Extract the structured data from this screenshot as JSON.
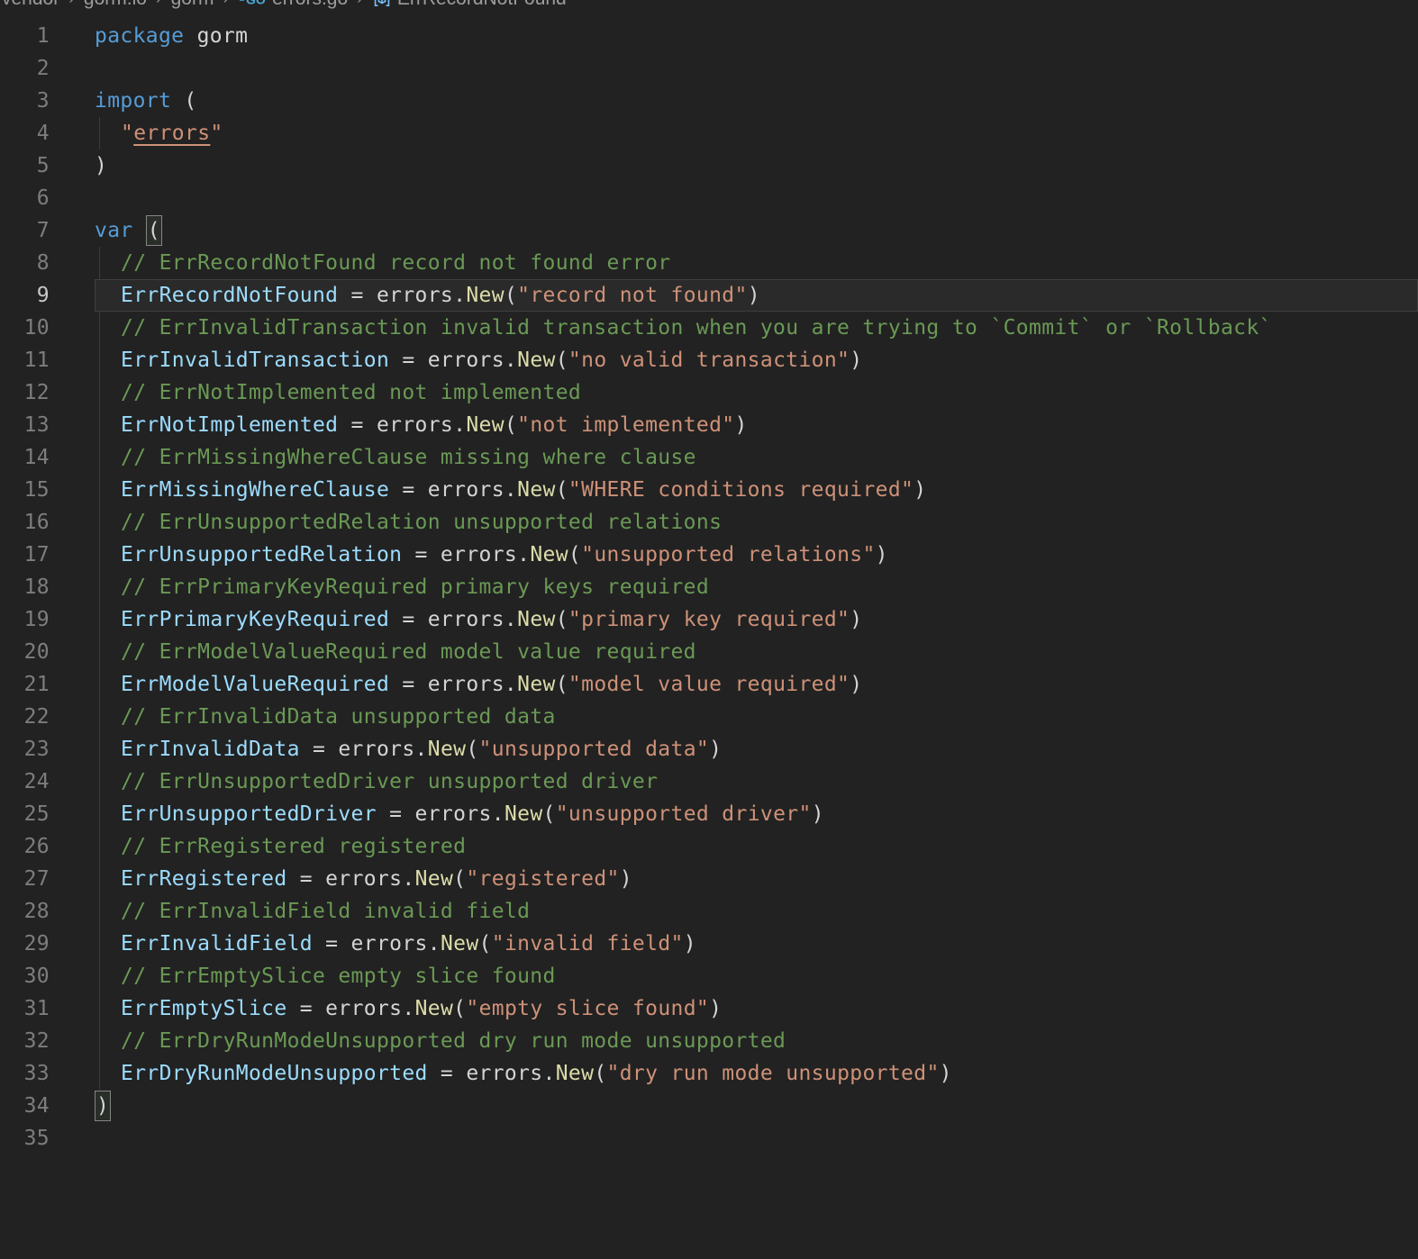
{
  "palette": {
    "bg": "#222222",
    "gutter-fg": "#7d7d7d",
    "gutter-active": "#c8c8c8",
    "kw": "#569cd6",
    "pl": "#d4d4d4",
    "cm": "#6a9955",
    "vr": "#9cdcfe",
    "fn": "#dcdcaa",
    "st": "#ce9178",
    "cur-bg": "#2a2a2a",
    "cur-border": "#3f3f3f",
    "guide": "#3c3c3c",
    "bracket": "#858585",
    "bc-fg": "#9d9d9d",
    "go-blue": "#4da6d6",
    "sym-blue": "#75beff"
  },
  "breadcrumb": {
    "separator": "›",
    "items": [
      {
        "label": "vendor"
      },
      {
        "label": "gorm.io"
      },
      {
        "label": "gorm"
      },
      {
        "label": "errors.go",
        "icon": "go-icon"
      },
      {
        "label": "ErrRecordNotFound",
        "icon": "symbol-variable-icon"
      }
    ]
  },
  "editor": {
    "lines": [
      {
        "n": 1,
        "indent": 0,
        "tokens": [
          [
            "kw",
            "package"
          ],
          [
            "pl",
            " gorm"
          ]
        ]
      },
      {
        "n": 2,
        "indent": 0,
        "tokens": []
      },
      {
        "n": 3,
        "indent": 0,
        "tokens": [
          [
            "kw",
            "import"
          ],
          [
            "pl",
            " ("
          ]
        ]
      },
      {
        "n": 4,
        "indent": 1,
        "guide": true,
        "tokens": [
          [
            "st",
            "\""
          ],
          [
            "stu",
            "errors"
          ],
          [
            "st",
            "\""
          ]
        ]
      },
      {
        "n": 5,
        "indent": 0,
        "tokens": [
          [
            "pl",
            ")"
          ]
        ]
      },
      {
        "n": 6,
        "indent": 0,
        "tokens": []
      },
      {
        "n": 7,
        "indent": 0,
        "tokens": [
          [
            "kw",
            "var"
          ],
          [
            "pl",
            " "
          ],
          [
            "bm",
            "("
          ]
        ]
      },
      {
        "n": 8,
        "indent": 1,
        "guide": true,
        "tokens": [
          [
            "cm",
            "// ErrRecordNotFound record not found error"
          ]
        ]
      },
      {
        "n": 9,
        "indent": 1,
        "current": true,
        "tokens": [
          [
            "vr",
            "ErrRecordNotFound"
          ],
          [
            "pl",
            " = errors."
          ],
          [
            "fn",
            "New"
          ],
          [
            "pl",
            "("
          ],
          [
            "st",
            "\"record not found\""
          ],
          [
            "pl",
            ")"
          ]
        ]
      },
      {
        "n": 10,
        "indent": 1,
        "guide": true,
        "tokens": [
          [
            "cm",
            "// ErrInvalidTransaction invalid transaction when you are trying to `Commit` or `Rollback`"
          ]
        ]
      },
      {
        "n": 11,
        "indent": 1,
        "guide": true,
        "tokens": [
          [
            "vr",
            "ErrInvalidTransaction"
          ],
          [
            "pl",
            " = errors."
          ],
          [
            "fn",
            "New"
          ],
          [
            "pl",
            "("
          ],
          [
            "st",
            "\"no valid transaction\""
          ],
          [
            "pl",
            ")"
          ]
        ]
      },
      {
        "n": 12,
        "indent": 1,
        "guide": true,
        "tokens": [
          [
            "cm",
            "// ErrNotImplemented not implemented"
          ]
        ]
      },
      {
        "n": 13,
        "indent": 1,
        "guide": true,
        "tokens": [
          [
            "vr",
            "ErrNotImplemented"
          ],
          [
            "pl",
            " = errors."
          ],
          [
            "fn",
            "New"
          ],
          [
            "pl",
            "("
          ],
          [
            "st",
            "\"not implemented\""
          ],
          [
            "pl",
            ")"
          ]
        ]
      },
      {
        "n": 14,
        "indent": 1,
        "guide": true,
        "tokens": [
          [
            "cm",
            "// ErrMissingWhereClause missing where clause"
          ]
        ]
      },
      {
        "n": 15,
        "indent": 1,
        "guide": true,
        "tokens": [
          [
            "vr",
            "ErrMissingWhereClause"
          ],
          [
            "pl",
            " = errors."
          ],
          [
            "fn",
            "New"
          ],
          [
            "pl",
            "("
          ],
          [
            "st",
            "\"WHERE conditions required\""
          ],
          [
            "pl",
            ")"
          ]
        ]
      },
      {
        "n": 16,
        "indent": 1,
        "guide": true,
        "tokens": [
          [
            "cm",
            "// ErrUnsupportedRelation unsupported relations"
          ]
        ]
      },
      {
        "n": 17,
        "indent": 1,
        "guide": true,
        "tokens": [
          [
            "vr",
            "ErrUnsupportedRelation"
          ],
          [
            "pl",
            " = errors."
          ],
          [
            "fn",
            "New"
          ],
          [
            "pl",
            "("
          ],
          [
            "st",
            "\"unsupported relations\""
          ],
          [
            "pl",
            ")"
          ]
        ]
      },
      {
        "n": 18,
        "indent": 1,
        "guide": true,
        "tokens": [
          [
            "cm",
            "// ErrPrimaryKeyRequired primary keys required"
          ]
        ]
      },
      {
        "n": 19,
        "indent": 1,
        "guide": true,
        "tokens": [
          [
            "vr",
            "ErrPrimaryKeyRequired"
          ],
          [
            "pl",
            " = errors."
          ],
          [
            "fn",
            "New"
          ],
          [
            "pl",
            "("
          ],
          [
            "st",
            "\"primary key required\""
          ],
          [
            "pl",
            ")"
          ]
        ]
      },
      {
        "n": 20,
        "indent": 1,
        "guide": true,
        "tokens": [
          [
            "cm",
            "// ErrModelValueRequired model value required"
          ]
        ]
      },
      {
        "n": 21,
        "indent": 1,
        "guide": true,
        "tokens": [
          [
            "vr",
            "ErrModelValueRequired"
          ],
          [
            "pl",
            " = errors."
          ],
          [
            "fn",
            "New"
          ],
          [
            "pl",
            "("
          ],
          [
            "st",
            "\"model value required\""
          ],
          [
            "pl",
            ")"
          ]
        ]
      },
      {
        "n": 22,
        "indent": 1,
        "guide": true,
        "tokens": [
          [
            "cm",
            "// ErrInvalidData unsupported data"
          ]
        ]
      },
      {
        "n": 23,
        "indent": 1,
        "guide": true,
        "tokens": [
          [
            "vr",
            "ErrInvalidData"
          ],
          [
            "pl",
            " = errors."
          ],
          [
            "fn",
            "New"
          ],
          [
            "pl",
            "("
          ],
          [
            "st",
            "\"unsupported data\""
          ],
          [
            "pl",
            ")"
          ]
        ]
      },
      {
        "n": 24,
        "indent": 1,
        "guide": true,
        "tokens": [
          [
            "cm",
            "// ErrUnsupportedDriver unsupported driver"
          ]
        ]
      },
      {
        "n": 25,
        "indent": 1,
        "guide": true,
        "tokens": [
          [
            "vr",
            "ErrUnsupportedDriver"
          ],
          [
            "pl",
            " = errors."
          ],
          [
            "fn",
            "New"
          ],
          [
            "pl",
            "("
          ],
          [
            "st",
            "\"unsupported driver\""
          ],
          [
            "pl",
            ")"
          ]
        ]
      },
      {
        "n": 26,
        "indent": 1,
        "guide": true,
        "tokens": [
          [
            "cm",
            "// ErrRegistered registered"
          ]
        ]
      },
      {
        "n": 27,
        "indent": 1,
        "guide": true,
        "tokens": [
          [
            "vr",
            "ErrRegistered"
          ],
          [
            "pl",
            " = errors."
          ],
          [
            "fn",
            "New"
          ],
          [
            "pl",
            "("
          ],
          [
            "st",
            "\"registered\""
          ],
          [
            "pl",
            ")"
          ]
        ]
      },
      {
        "n": 28,
        "indent": 1,
        "guide": true,
        "tokens": [
          [
            "cm",
            "// ErrInvalidField invalid field"
          ]
        ]
      },
      {
        "n": 29,
        "indent": 1,
        "guide": true,
        "tokens": [
          [
            "vr",
            "ErrInvalidField"
          ],
          [
            "pl",
            " = errors."
          ],
          [
            "fn",
            "New"
          ],
          [
            "pl",
            "("
          ],
          [
            "st",
            "\"invalid field\""
          ],
          [
            "pl",
            ")"
          ]
        ]
      },
      {
        "n": 30,
        "indent": 1,
        "guide": true,
        "tokens": [
          [
            "cm",
            "// ErrEmptySlice empty slice found"
          ]
        ]
      },
      {
        "n": 31,
        "indent": 1,
        "guide": true,
        "tokens": [
          [
            "vr",
            "ErrEmptySlice"
          ],
          [
            "pl",
            " = errors."
          ],
          [
            "fn",
            "New"
          ],
          [
            "pl",
            "("
          ],
          [
            "st",
            "\"empty slice found\""
          ],
          [
            "pl",
            ")"
          ]
        ]
      },
      {
        "n": 32,
        "indent": 1,
        "guide": true,
        "tokens": [
          [
            "cm",
            "// ErrDryRunModeUnsupported dry run mode unsupported"
          ]
        ]
      },
      {
        "n": 33,
        "indent": 1,
        "guide": true,
        "tokens": [
          [
            "vr",
            "ErrDryRunModeUnsupported"
          ],
          [
            "pl",
            " = errors."
          ],
          [
            "fn",
            "New"
          ],
          [
            "pl",
            "("
          ],
          [
            "st",
            "\"dry run mode unsupported\""
          ],
          [
            "pl",
            ")"
          ]
        ]
      },
      {
        "n": 34,
        "indent": 0,
        "tokens": [
          [
            "bm",
            ")"
          ]
        ]
      },
      {
        "n": 35,
        "indent": 0,
        "tokens": []
      }
    ]
  }
}
